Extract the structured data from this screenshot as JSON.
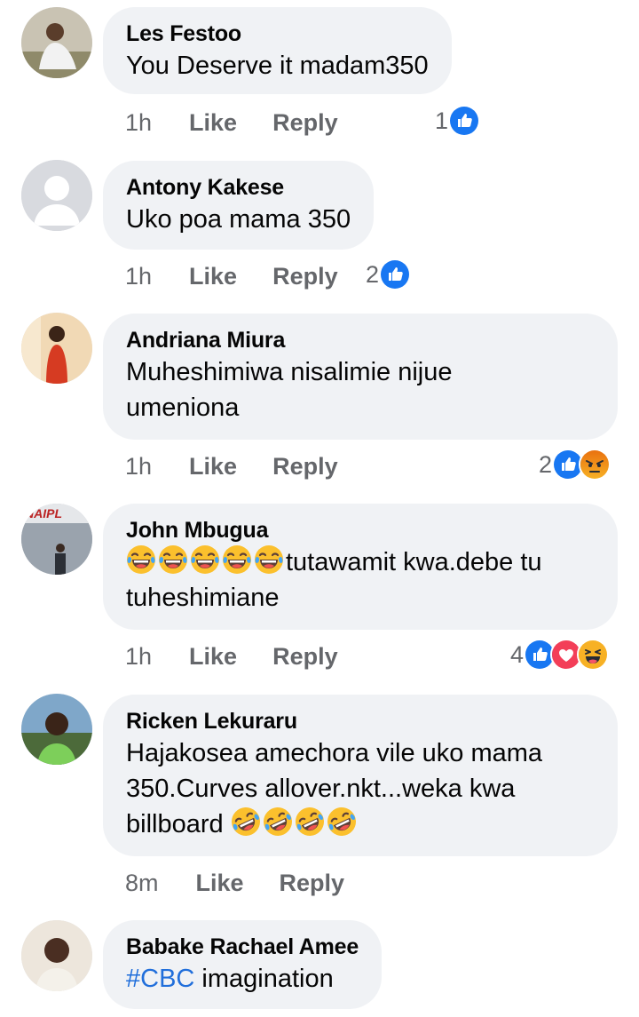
{
  "actions": {
    "like": "Like",
    "reply": "Reply"
  },
  "comments": [
    {
      "author": "Les Festoo",
      "text": "You Deserve it madam350",
      "time": "1h",
      "reaction_count": "1",
      "reactions": [
        "like"
      ]
    },
    {
      "author": "Antony Kakese",
      "text": "Uko poa mama 350",
      "time": "1h",
      "reaction_count": "2",
      "reactions": [
        "like"
      ]
    },
    {
      "author": "Andriana Miura",
      "text_line1": "Muheshimiwa nisalimie nijue",
      "text_line2": "umeniona",
      "time": "1h",
      "reaction_count": "2",
      "reactions": [
        "like",
        "angry"
      ]
    },
    {
      "author": "John Mbugua",
      "text_after_emoji": "tutawamit kwa.debe tu",
      "text_line2": "tuheshimiane",
      "emoji": [
        "joy",
        "joy",
        "joy",
        "joy",
        "joy"
      ],
      "time": "1h",
      "reaction_count": "4",
      "reactions": [
        "like",
        "love",
        "haha"
      ]
    },
    {
      "author": "Ricken Lekuraru",
      "text_line1": "Hajakosea amechora vile uko mama",
      "text_line2": "350.Curves allover.nkt...weka kwa",
      "text_line3": "billboard",
      "emoji": [
        "rofl",
        "rofl",
        "rofl",
        "rofl"
      ],
      "time": "8m"
    },
    {
      "author": "Babake Rachael Amee",
      "hashtag": "#CBC",
      "text": " imagination"
    }
  ],
  "colors": {
    "bubble": "#f0f2f5",
    "muted": "#65676b",
    "like_blue": "#1877f2",
    "love_red": "#f33e58",
    "haha_yellow": "#f7b125",
    "hashtag": "#216fdb"
  }
}
